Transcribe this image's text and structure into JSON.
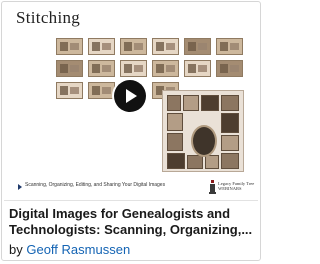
{
  "course": {
    "slide_title": "Stitching",
    "caption": "Scanning, Organizing, Editing, and Sharing Your Digital Images",
    "logo_text_line1": "Legacy Family Tree",
    "logo_text_line2": "WEBINARS",
    "title_line1": "Digital Images for Genealogists and",
    "title_line2": "Technologists: Scanning, Organizing,...",
    "author_prefix": "by",
    "author_name": "Geoff Rasmussen"
  },
  "icons": {
    "play": "play-button-icon",
    "caption_marker": "play-triangle-icon",
    "logo": "legacy-logo-icon"
  },
  "colors": {
    "accent_link": "#1464b4",
    "title": "#1a1a1a",
    "play_button": "#111111"
  }
}
